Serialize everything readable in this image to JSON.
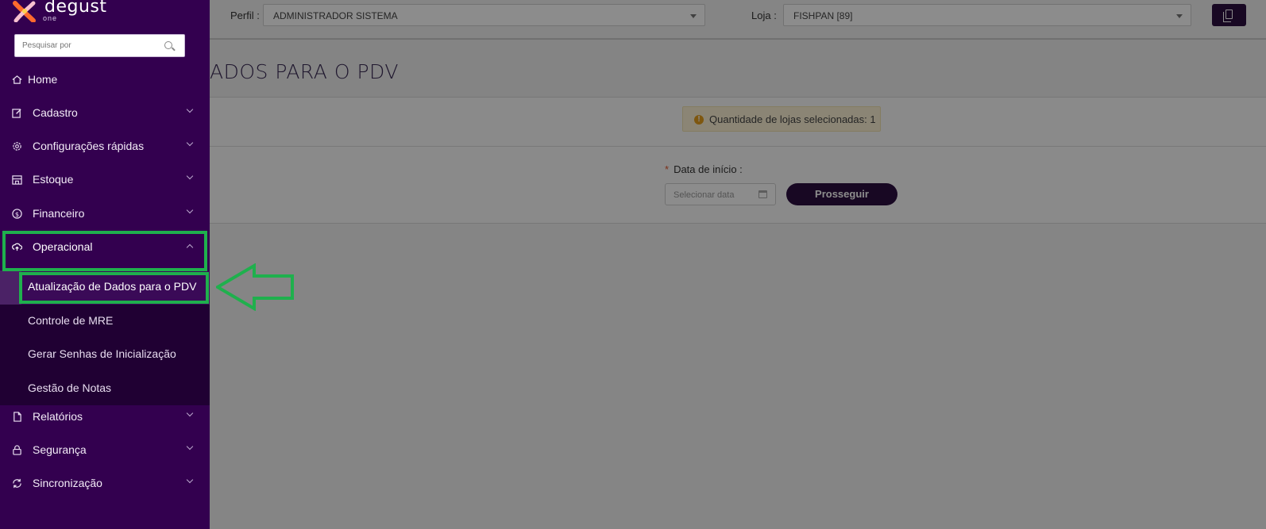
{
  "topbar": {
    "perfil_label": "Perfil",
    "perfil_value": "ADMINISTRADOR SISTEMA",
    "loja_label": "Loja",
    "loja_value": "FISHPAN [89]"
  },
  "page": {
    "title": "ADOS PARA O PDV",
    "alert_text": "Quantidade de lojas selecionadas: 1",
    "date_label": "Data de início",
    "date_placeholder": "Selecionar data",
    "proceed_label": "Prosseguir"
  },
  "logo": {
    "word": "degust",
    "sub": "one"
  },
  "search": {
    "placeholder": "Pesquisar por"
  },
  "sidebar": {
    "items": [
      {
        "label": "Home",
        "icon": "home-icon"
      },
      {
        "label": "Cadastro",
        "icon": "edit-icon"
      },
      {
        "label": "Configurações rápidas",
        "icon": "gear-icon"
      },
      {
        "label": "Estoque",
        "icon": "store-icon"
      },
      {
        "label": "Financeiro",
        "icon": "dollar-icon"
      },
      {
        "label": "Operacional",
        "icon": "cloud-upload-icon"
      },
      {
        "label": "Relatórios",
        "icon": "file-icon"
      },
      {
        "label": "Segurança",
        "icon": "lock-icon"
      },
      {
        "label": "Sincronização",
        "icon": "sync-icon"
      }
    ],
    "operacional_sub": [
      {
        "label": "Atualização de Dados para o PDV"
      },
      {
        "label": "Controle de MRE"
      },
      {
        "label": "Gerar Senhas de Inicialização"
      },
      {
        "label": "Gestão de Notas"
      }
    ]
  },
  "colors": {
    "sidebar_bg": "#33004f",
    "submenu_bg": "#200033",
    "primary_button": "#2d1040",
    "highlight_green": "#1fb04d",
    "alert_bg": "#fdf3d6"
  }
}
